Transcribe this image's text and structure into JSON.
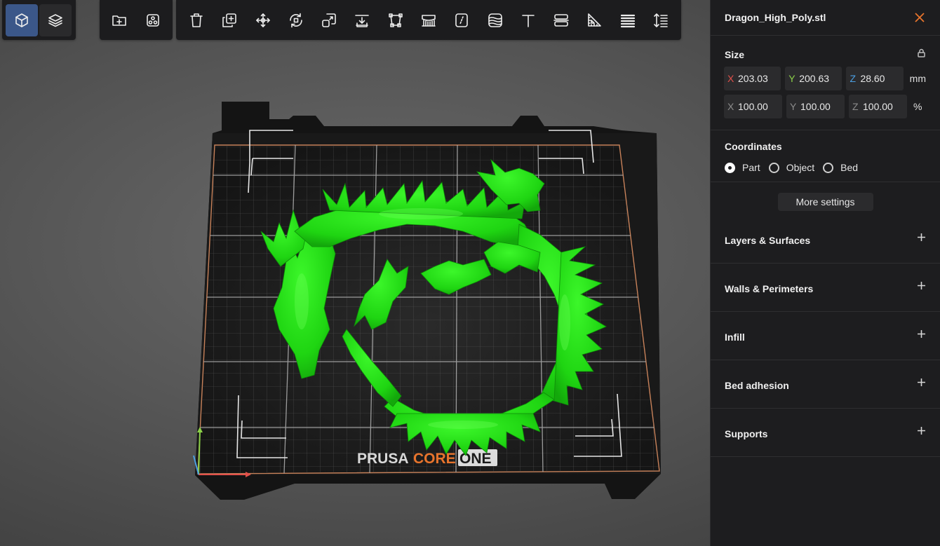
{
  "view_toolbar": {
    "items": [
      {
        "name": "3d-view-icon",
        "active": true
      },
      {
        "name": "layers-view-icon",
        "active": false
      }
    ]
  },
  "file_toolbar": {
    "items": [
      {
        "name": "add-file-icon"
      },
      {
        "name": "arrange-icon"
      }
    ]
  },
  "edit_toolbar": {
    "items": [
      {
        "name": "delete-icon"
      },
      {
        "name": "duplicate-icon"
      },
      {
        "name": "move-icon"
      },
      {
        "name": "rotate-icon"
      },
      {
        "name": "scale-icon"
      },
      {
        "name": "place-on-face-icon"
      },
      {
        "name": "cut-icon"
      },
      {
        "name": "paint-supports-icon"
      },
      {
        "name": "seam-paint-icon"
      },
      {
        "name": "fuzzy-skin-icon"
      },
      {
        "name": "text-icon"
      },
      {
        "name": "split-icon"
      },
      {
        "name": "measure-icon"
      },
      {
        "name": "layer-height-icon"
      },
      {
        "name": "variable-layer-icon"
      }
    ]
  },
  "panel": {
    "file_name": "Dragon_High_Poly.stl",
    "accent_color": "#e8742c",
    "size": {
      "title": "Size",
      "mm": {
        "x": "203.03",
        "y": "200.63",
        "z": "28.60",
        "unit": "mm"
      },
      "percent": {
        "x": "100.00",
        "y": "100.00",
        "z": "100.00",
        "unit": "%"
      },
      "axis_labels": {
        "x": "X",
        "y": "Y",
        "z": "Z"
      }
    },
    "coordinates": {
      "title": "Coordinates",
      "options": [
        "Part",
        "Object",
        "Bed"
      ],
      "selected": "Part"
    },
    "more_settings_label": "More settings",
    "sections": [
      {
        "label": "Layers & Surfaces"
      },
      {
        "label": "Walls & Perimeters"
      },
      {
        "label": "Infill"
      },
      {
        "label": "Bed adhesion"
      },
      {
        "label": "Supports"
      }
    ]
  },
  "bed": {
    "logo_prusa": "PRUSA",
    "logo_core": "CORE",
    "logo_one": "ONE",
    "model_color": "#22e414"
  }
}
